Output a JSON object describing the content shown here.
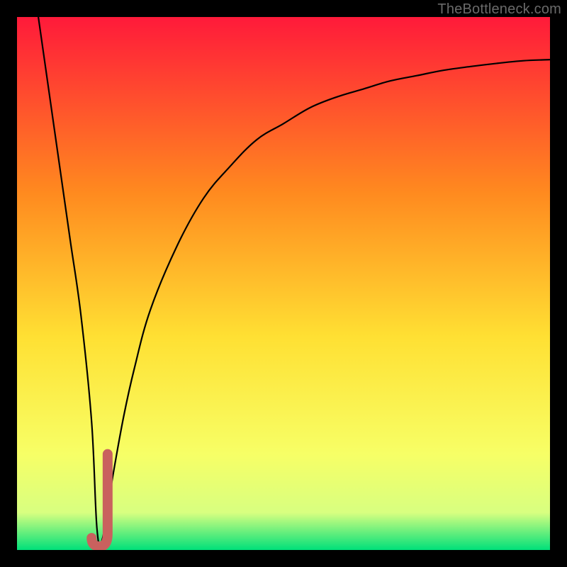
{
  "watermark": "TheBottleneck.com",
  "colors": {
    "frame": "#000000",
    "grad_top": "#ff1a3a",
    "grad_mid1": "#ff8a1f",
    "grad_mid2": "#ffe033",
    "grad_mid3": "#f7ff66",
    "grad_low": "#d8ff80",
    "grad_bottom": "#00e07a",
    "curve": "#000000",
    "marker": "#c9615e"
  },
  "chart_data": {
    "type": "line",
    "title": "",
    "xlabel": "",
    "ylabel": "",
    "xlim": [
      0,
      100
    ],
    "ylim": [
      0,
      100
    ],
    "series": [
      {
        "name": "bottleneck-curve",
        "x": [
          4,
          6,
          8,
          10,
          12,
          14,
          15,
          16,
          18,
          20,
          22,
          25,
          30,
          35,
          40,
          45,
          50,
          55,
          60,
          65,
          70,
          75,
          80,
          85,
          90,
          95,
          100
        ],
        "values": [
          100,
          86,
          72,
          58,
          44,
          24,
          4,
          2,
          14,
          25,
          34,
          45,
          57,
          66,
          72,
          77,
          80,
          83,
          85,
          86.5,
          88,
          89,
          90,
          90.7,
          91.3,
          91.8,
          92
        ]
      }
    ],
    "annotations": [
      {
        "name": "optimal-marker",
        "shape": "J-hook",
        "x_range": [
          14,
          17
        ],
        "y_range": [
          2,
          18
        ],
        "color": "#c9615e"
      }
    ],
    "background_gradient": {
      "stops": [
        {
          "offset": 0.0,
          "color": "#ff1a3a"
        },
        {
          "offset": 0.33,
          "color": "#ff8a1f"
        },
        {
          "offset": 0.6,
          "color": "#ffe033"
        },
        {
          "offset": 0.82,
          "color": "#f7ff66"
        },
        {
          "offset": 0.93,
          "color": "#d8ff80"
        },
        {
          "offset": 1.0,
          "color": "#00e07a"
        }
      ]
    }
  }
}
